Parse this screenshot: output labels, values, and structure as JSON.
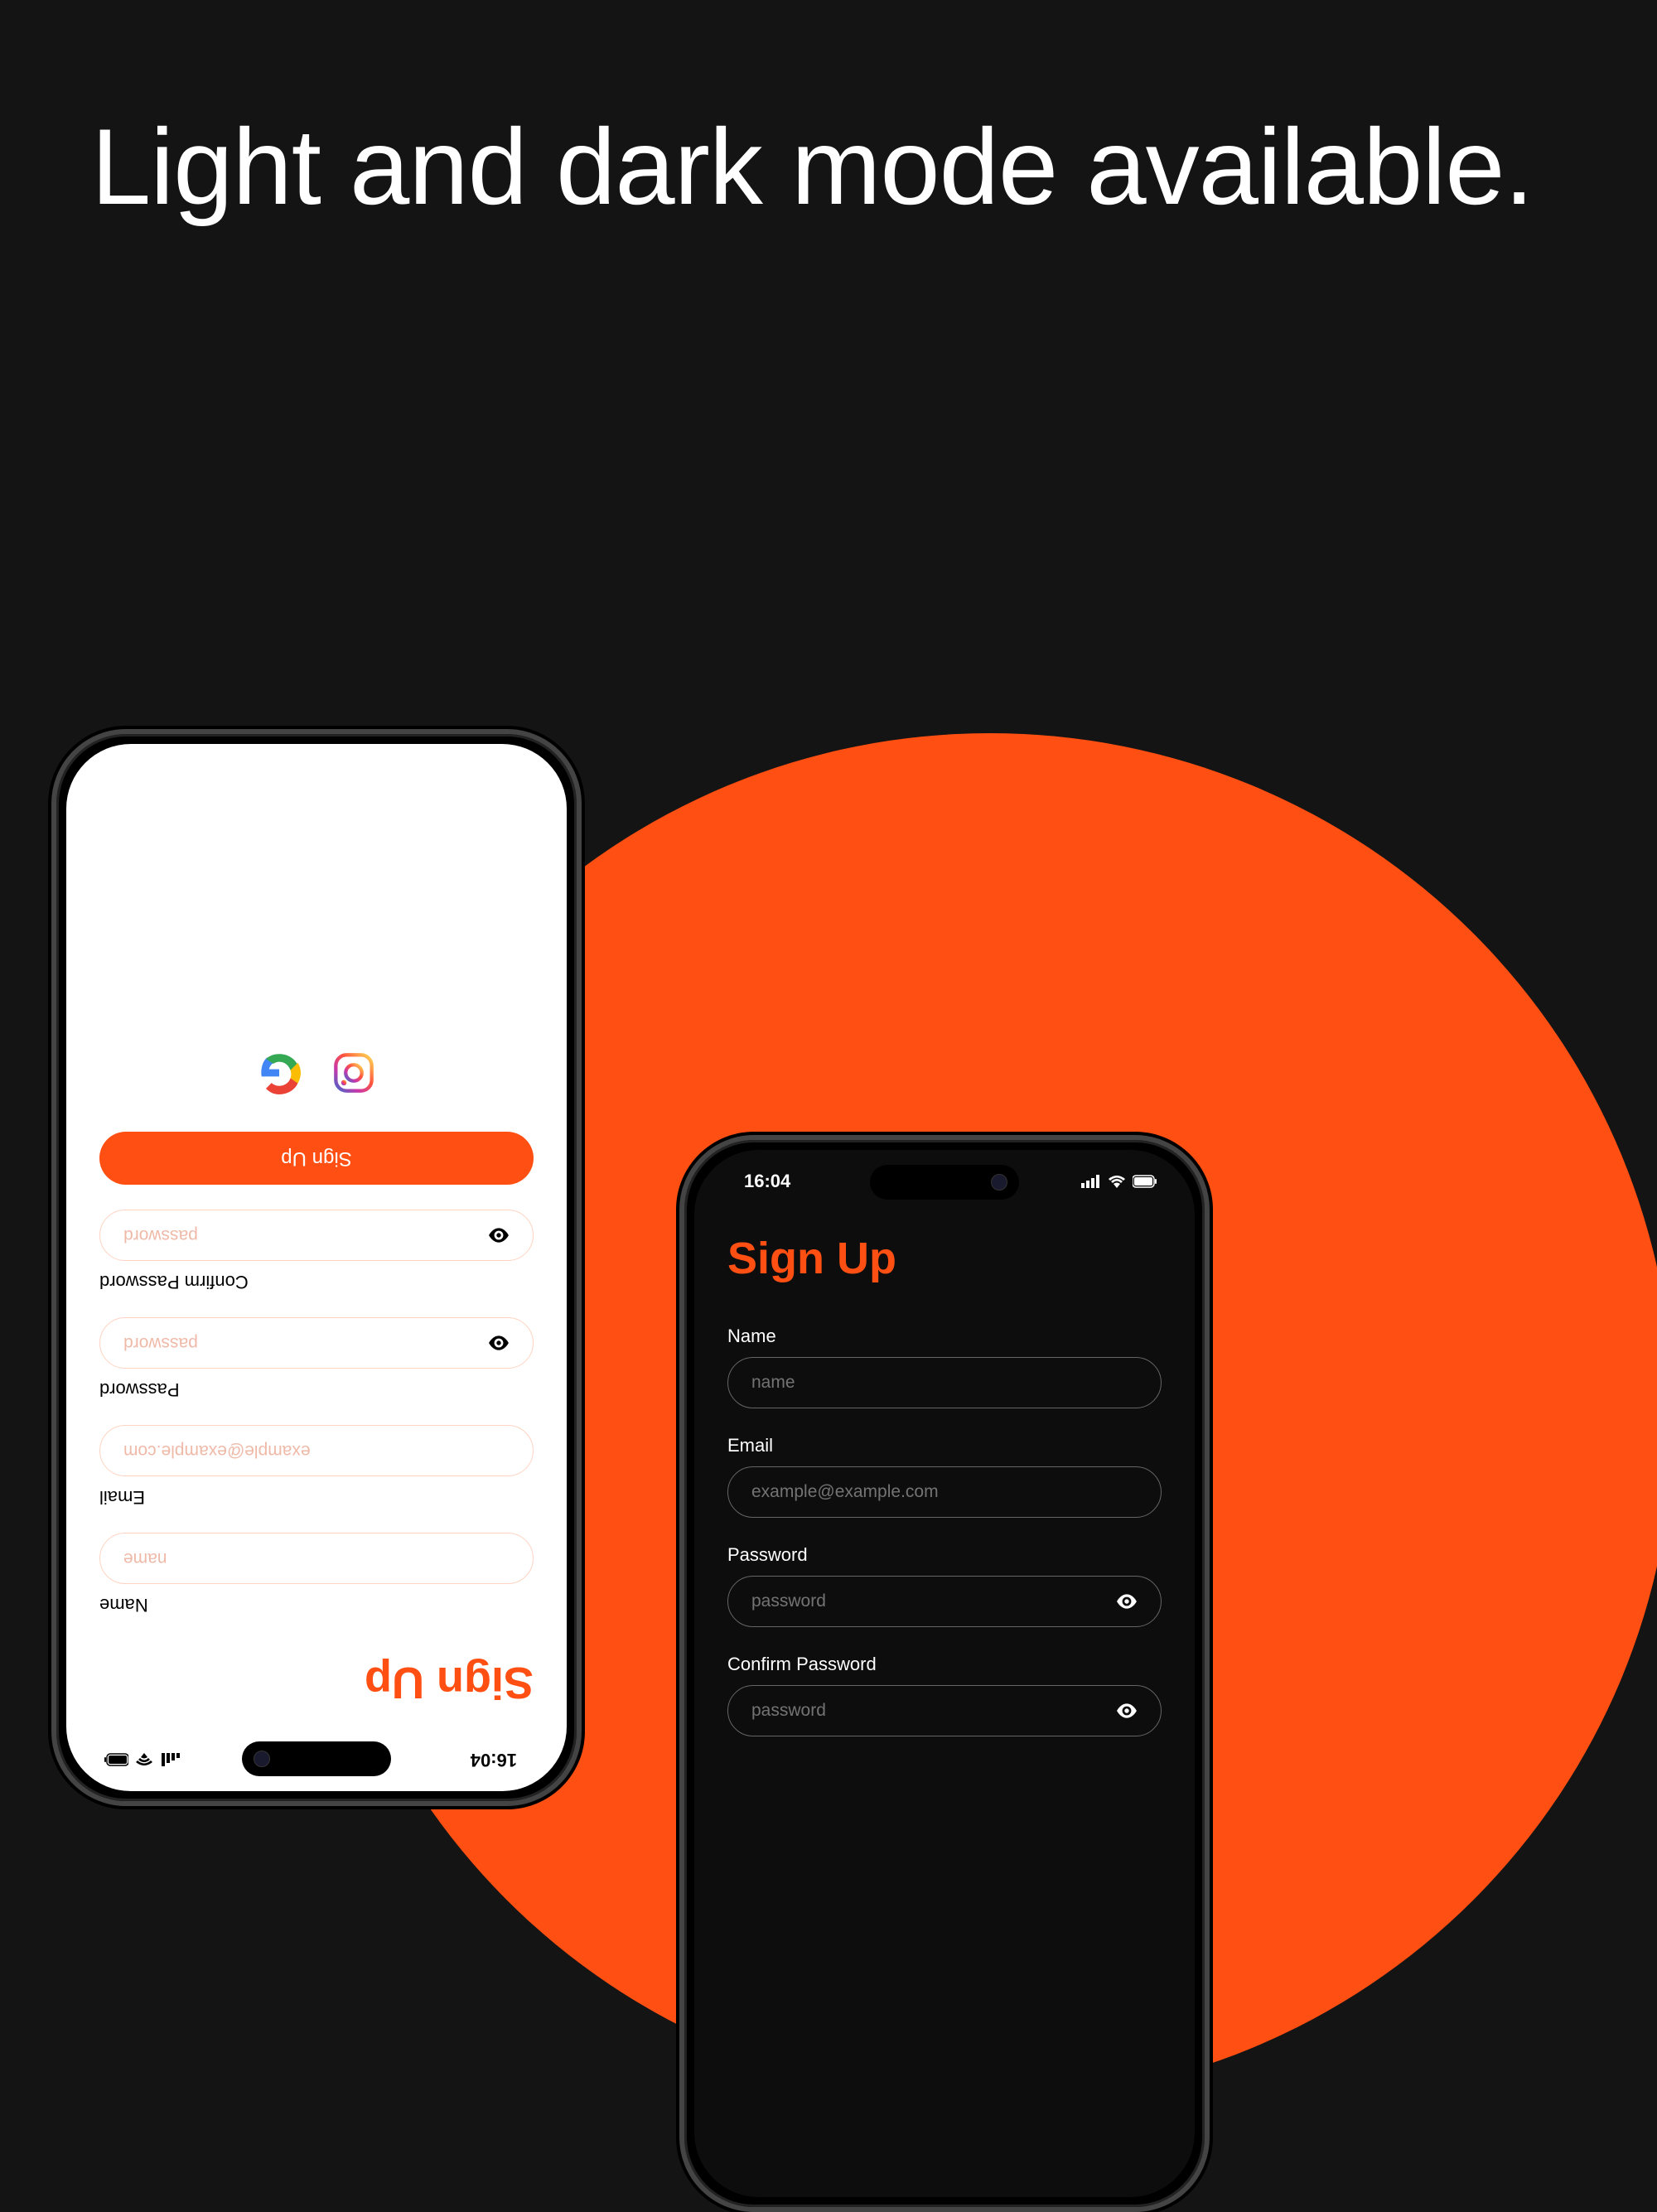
{
  "headline": "Light and dark mode available.",
  "status": {
    "time": "16:04"
  },
  "colors": {
    "accent": "#ff4f12",
    "bg_dark": "#141414"
  },
  "signup": {
    "title": "Sign Up",
    "button": "Sign Up",
    "fields": {
      "name": {
        "label": "Name",
        "placeholder": "name"
      },
      "email": {
        "label": "Email",
        "placeholder": "example@example.com"
      },
      "password": {
        "label": "Password",
        "placeholder": "password"
      },
      "confirm": {
        "label": "Confirm Password",
        "placeholder": "password"
      }
    }
  },
  "social": {
    "items": [
      "instagram",
      "google"
    ]
  }
}
